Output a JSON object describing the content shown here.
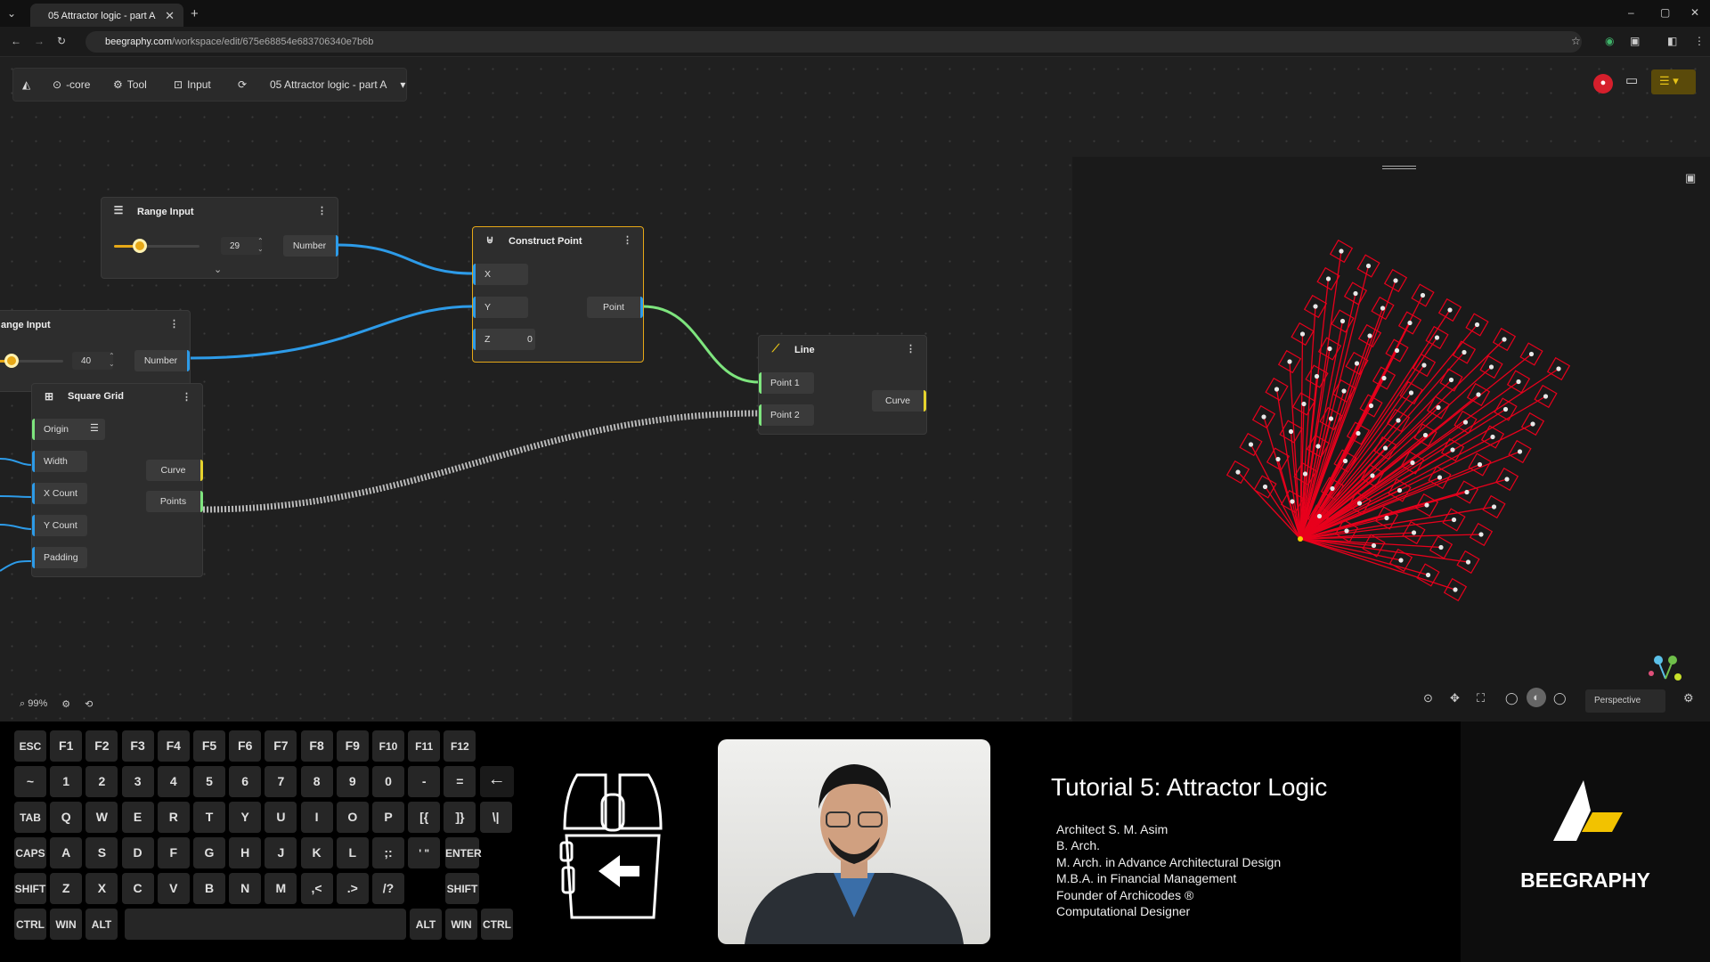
{
  "browser": {
    "tab_title": "05 Attractor logic - part A",
    "url_domain": "beegraphy.com",
    "url_path": "/workspace/edit/675e68854e683706340e7b6b"
  },
  "toolbar": {
    "core_label": "-core",
    "tool_label": "Tool",
    "input_label": "Input",
    "project_name": "05 Attractor logic - part A"
  },
  "nodes": {
    "range1": {
      "title": "Range Input",
      "value": "29",
      "output": "Number",
      "fraction": 0.3
    },
    "range2": {
      "title": "ange Input",
      "value": "40",
      "output": "Number",
      "fraction": 0.4
    },
    "construct_point": {
      "title": "Construct Point",
      "inputs": [
        "X",
        "Y",
        "Z"
      ],
      "z_value": "0",
      "output": "Point"
    },
    "line": {
      "title": "Line",
      "inputs": [
        "Point 1",
        "Point 2"
      ],
      "output": "Curve"
    },
    "square_grid": {
      "title": "Square Grid",
      "inputs": [
        "Origin",
        "Width",
        "X Count",
        "Y Count",
        "Padding"
      ],
      "outputs": [
        "Curve",
        "Points"
      ]
    }
  },
  "zoom": {
    "level": "99%"
  },
  "viewport": {
    "mode": "Perspective"
  },
  "keyboard": {
    "row1": [
      "ESC",
      "F1",
      "F2",
      "F3",
      "F4",
      "F5",
      "F6",
      "F7",
      "F8",
      "F9",
      "F10",
      "F11",
      "F12"
    ],
    "row2": [
      "~",
      "1",
      "2",
      "3",
      "4",
      "5",
      "6",
      "7",
      "8",
      "9",
      "0",
      "-",
      "="
    ],
    "row3": [
      "TAB",
      "Q",
      "W",
      "E",
      "R",
      "T",
      "Y",
      "U",
      "I",
      "O",
      "P",
      "[{",
      "]}",
      "\\|"
    ],
    "row4": [
      "CAPS",
      "A",
      "S",
      "D",
      "F",
      "G",
      "H",
      "J",
      "K",
      "L",
      ";:",
      "' \"",
      "ENTER"
    ],
    "row5": [
      "SHIFT",
      "Z",
      "X",
      "C",
      "V",
      "B",
      "N",
      "M",
      ",<",
      ".>",
      "/?",
      "SHIFT"
    ],
    "row6": [
      "CTRL",
      "WIN",
      "ALT",
      "ALT",
      "WIN",
      "CTRL"
    ]
  },
  "tutorial": {
    "title": "Tutorial 5: Attractor Logic",
    "lines": [
      "Architect S. M. Asim",
      "B. Arch.",
      "M. Arch. in Advance Architectural Design",
      "M.B.A. in Financial Management",
      "Founder of Archicodes ®",
      "Computational Designer"
    ]
  },
  "brand": {
    "name": "BEEGRAPHY"
  },
  "colors": {
    "accent": "#e6a817",
    "wire_blue": "#2d9be8",
    "wire_green": "#7ee57e",
    "lines_red": "#e8001c"
  }
}
